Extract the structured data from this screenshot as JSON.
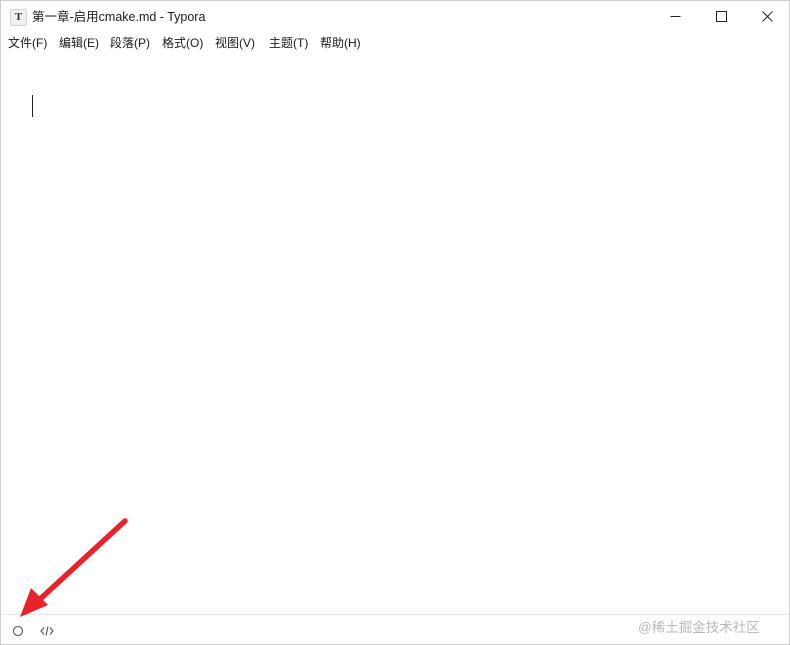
{
  "window": {
    "title": "第一章-启用cmake.md - Typora",
    "app_icon_glyph": "T"
  },
  "menu": [
    {
      "label": "文件(F)"
    },
    {
      "label": "编辑(E)"
    },
    {
      "label": "段落(P)"
    },
    {
      "label": "格式(O)"
    },
    {
      "label": "视图(V)"
    },
    {
      "label": "主题(T)"
    },
    {
      "label": "帮助(H)"
    }
  ],
  "statusbar": {
    "watermark": "@稀土掘金技术社区"
  },
  "icons": {
    "sidebar_toggle": "circle-icon",
    "source_mode": "code-icon"
  },
  "colors": {
    "annotation_arrow": "#e8232b"
  }
}
